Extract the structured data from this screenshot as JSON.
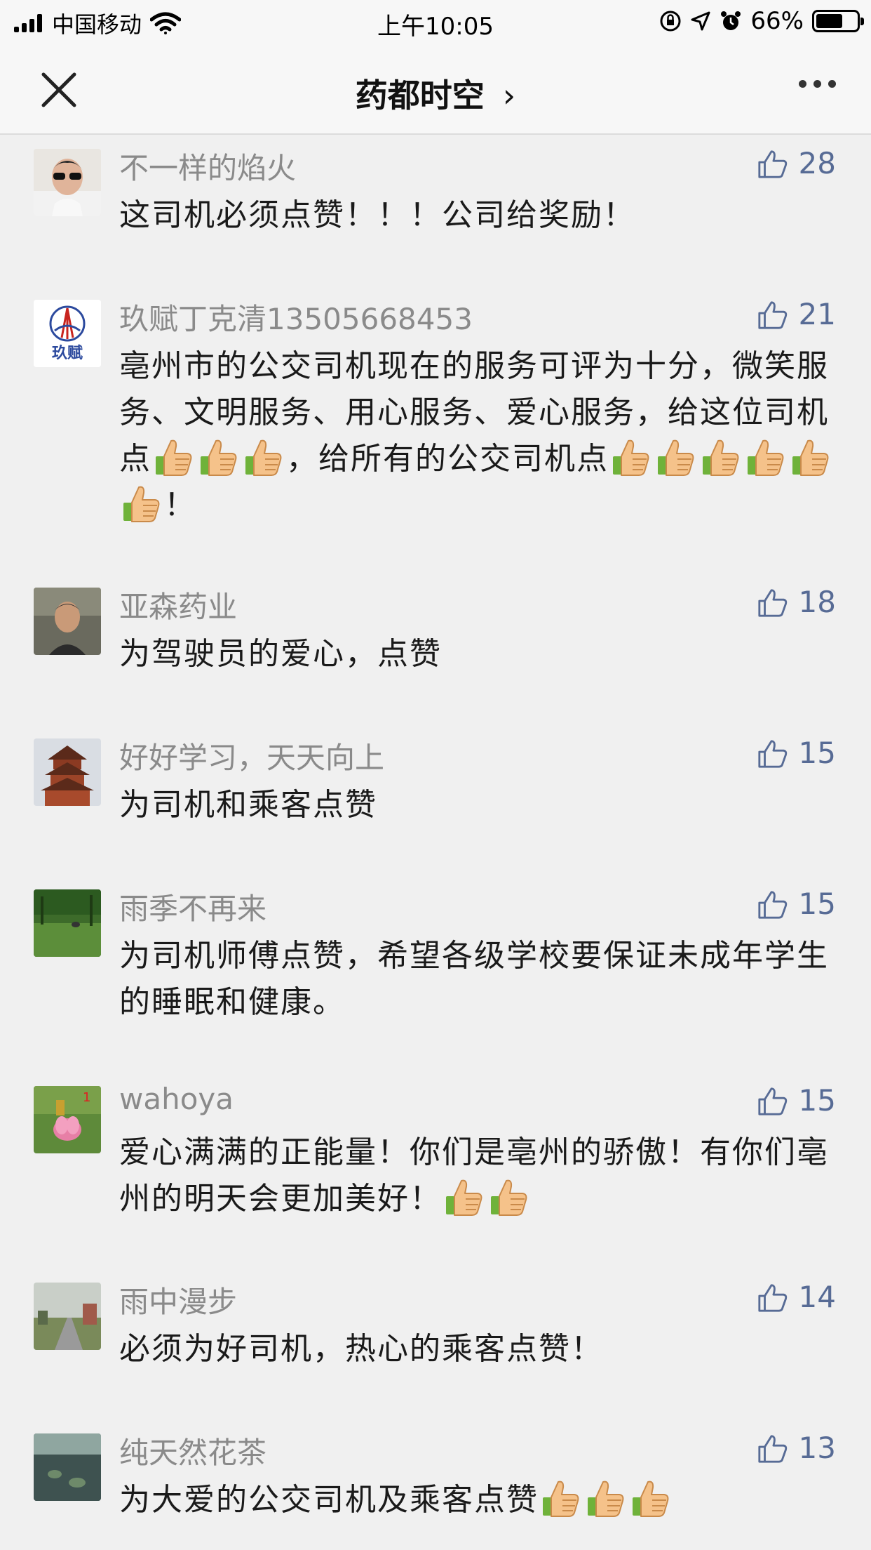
{
  "status_bar": {
    "carrier": "中国移动",
    "time": "上午10:05",
    "battery_percent": "66%",
    "battery_level": 0.66
  },
  "navbar": {
    "title": "药都时空",
    "title_chevron": "›",
    "close_icon": "close-icon",
    "more_icon": "more-icon"
  },
  "comments": [
    {
      "name": "不一样的焰火",
      "text": "这司机必须点赞！！！公司给奖励！",
      "likes": "28",
      "thumbs_after": 0
    },
    {
      "name": "玖赋丁克清13505668453",
      "text_parts": [
        "亳州市的公交司机现在的服务可评为十分，微笑服务、文明服务、用心服务、爱心服务，给这位司机点",
        "，给所有的公交司机点",
        "！"
      ],
      "likes": "21"
    },
    {
      "name": "亚森药业",
      "text": "为驾驶员的爱心，点赞",
      "likes": "18"
    },
    {
      "name": "好好学习，天天向上",
      "text": "为司机和乘客点赞",
      "likes": "15"
    },
    {
      "name": "雨季不再来",
      "text": "为司机师傅点赞，希望各级学校要保证未成年学生的睡眠和健康。",
      "likes": "15"
    },
    {
      "name": "wahoya",
      "text": "爱心满满的正能量！你们是亳州的骄傲！有你们亳州的明天会更加美好！",
      "likes": "15"
    },
    {
      "name": "雨中漫步",
      "text": "必须为好司机，热心的乘客点赞！",
      "likes": "14"
    },
    {
      "name": "纯天然花茶",
      "text": "为大爱的公交司机及乘客点赞",
      "likes": "13"
    }
  ],
  "avatar_logo_text": "玖赋",
  "colors": {
    "link_blue": "#576b95",
    "name_gray": "#8a8a8a",
    "background": "#f0f0f0"
  }
}
